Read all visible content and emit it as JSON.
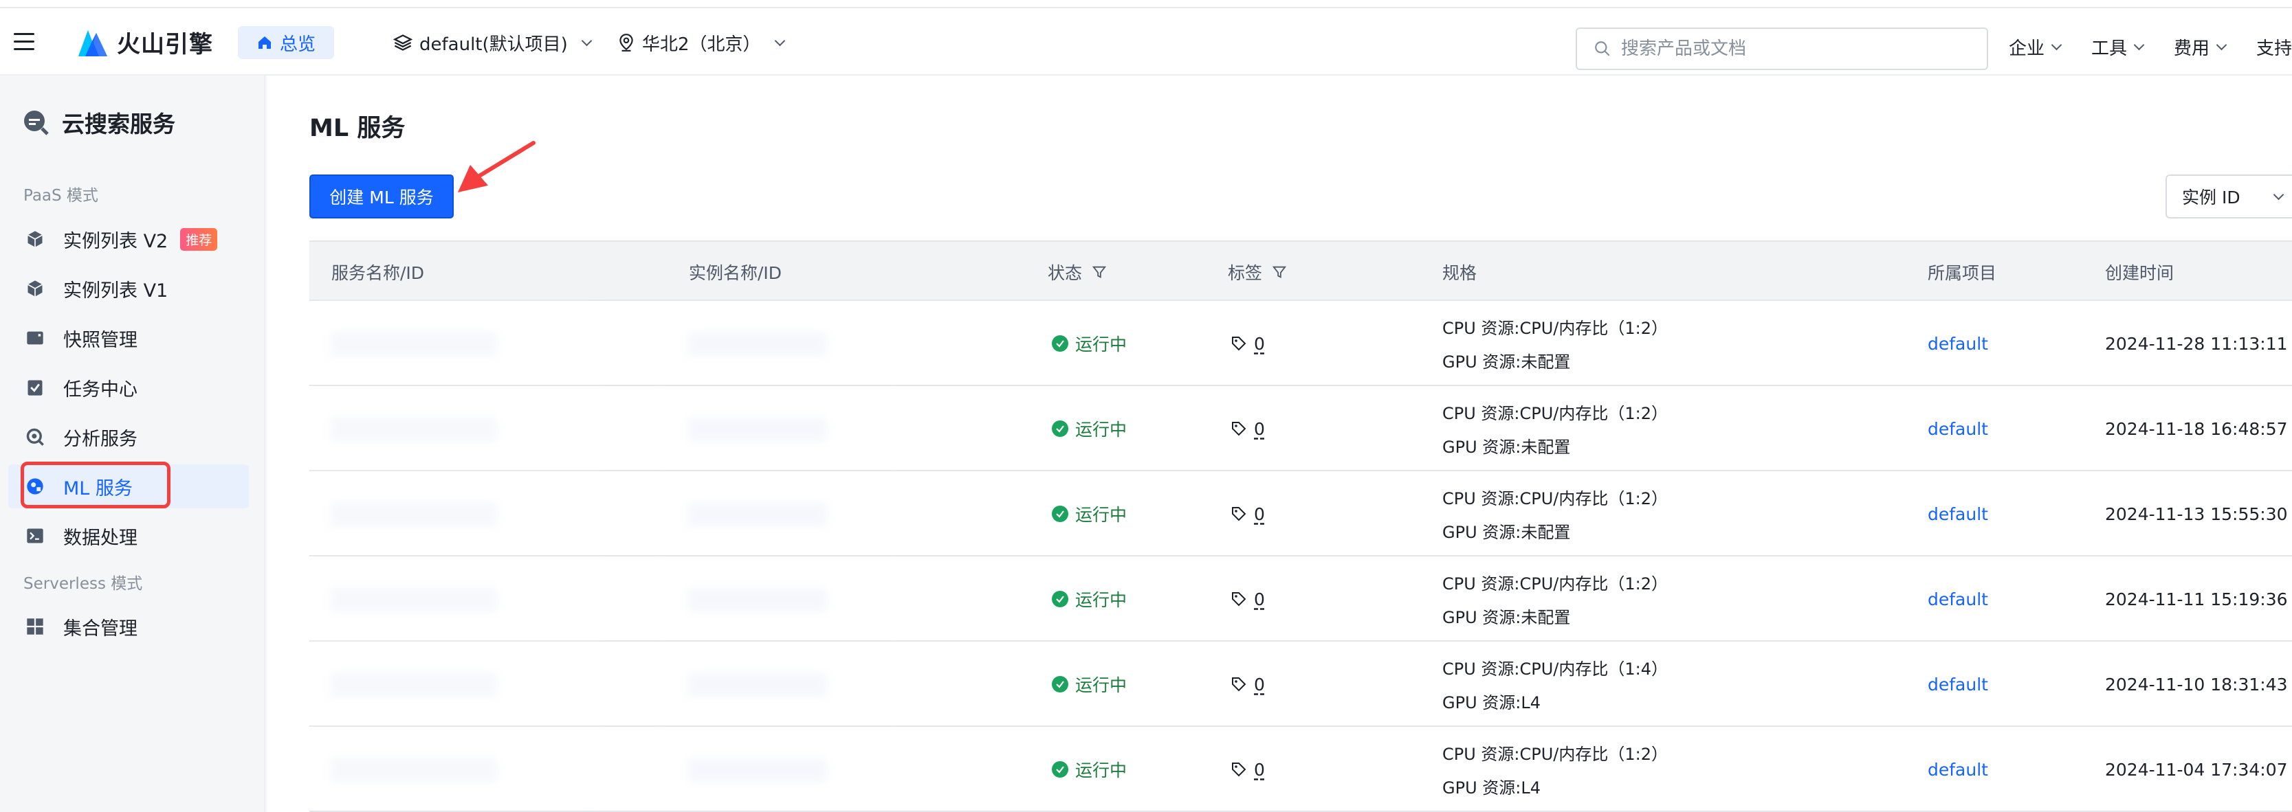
{
  "topbar": {
    "brand": "火山引擎",
    "home_label": "总览",
    "project": "default(默认项目)",
    "region": "华北2（北京）",
    "search_placeholder": "搜索产品或文档",
    "menu": [
      "企业",
      "工具",
      "费用",
      "支持"
    ]
  },
  "sidebar": {
    "service_title": "云搜索服务",
    "section_paas": "PaaS 模式",
    "section_serverless": "Serverless 模式",
    "items": [
      {
        "label": "实例列表 V2",
        "badge": "推荐",
        "icon": "cube-icon"
      },
      {
        "label": "实例列表 V1",
        "icon": "cube-icon"
      },
      {
        "label": "快照管理",
        "icon": "snapshot-icon"
      },
      {
        "label": "任务中心",
        "icon": "task-check-icon"
      },
      {
        "label": "分析服务",
        "icon": "analysis-search-icon"
      },
      {
        "label": "ML 服务",
        "icon": "ml-icon",
        "active": true
      },
      {
        "label": "数据处理",
        "icon": "terminal-icon"
      },
      {
        "label": "集合管理",
        "icon": "grid-icon"
      }
    ]
  },
  "main": {
    "title": "ML 服务",
    "create_button": "创建 ML 服务",
    "filter_select": "实例 ID",
    "columns": [
      "服务名称/ID",
      "实例名称/ID",
      "状态",
      "标签",
      "规格",
      "所属项目",
      "创建时间"
    ],
    "rows": [
      {
        "status": "运行中",
        "tags": "0",
        "cpu": "CPU 资源:CPU/内存比（1:2）",
        "gpu": "GPU 资源:未配置",
        "project": "default",
        "created": "2024-11-28 11:13:11"
      },
      {
        "status": "运行中",
        "tags": "0",
        "cpu": "CPU 资源:CPU/内存比（1:2）",
        "gpu": "GPU 资源:未配置",
        "project": "default",
        "created": "2024-11-18 16:48:57"
      },
      {
        "status": "运行中",
        "tags": "0",
        "cpu": "CPU 资源:CPU/内存比（1:2）",
        "gpu": "GPU 资源:未配置",
        "project": "default",
        "created": "2024-11-13 15:55:30"
      },
      {
        "status": "运行中",
        "tags": "0",
        "cpu": "CPU 资源:CPU/内存比（1:2）",
        "gpu": "GPU 资源:未配置",
        "project": "default",
        "created": "2024-11-11 15:19:36"
      },
      {
        "status": "运行中",
        "tags": "0",
        "cpu": "CPU 资源:CPU/内存比（1:4）",
        "gpu": "GPU 资源:L4",
        "project": "default",
        "created": "2024-11-10 18:31:43"
      },
      {
        "status": "运行中",
        "tags": "0",
        "cpu": "CPU 资源:CPU/内存比（1:2）",
        "gpu": "GPU 资源:L4",
        "project": "default",
        "created": "2024-11-04 17:34:07"
      }
    ]
  },
  "colors": {
    "accent": "#1664ff",
    "running": "#1aa35c",
    "annotation": "#f53f3f"
  }
}
